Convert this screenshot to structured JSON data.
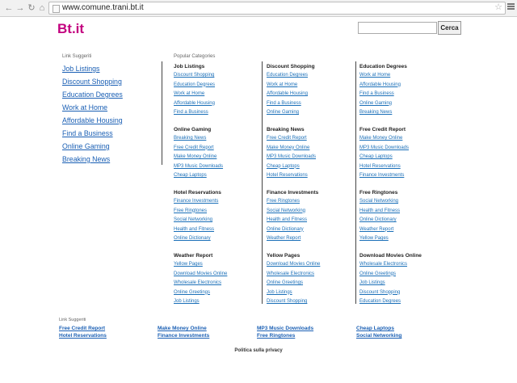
{
  "browser": {
    "url": "www.comune.trani.bt.it"
  },
  "header": {
    "logo": "Bt.it",
    "search_button": "Cerca",
    "search_value": ""
  },
  "left": {
    "heading": "Link Suggeriti",
    "links": [
      "Job Listings",
      "Discount Shopping",
      "Education Degrees",
      "Work at Home",
      "Affordable Housing",
      "Find a Business",
      "Online Gaming",
      "Breaking News"
    ]
  },
  "popular": {
    "heading": "Popular Categories",
    "columns": [
      [
        {
          "title": "Job Listings",
          "links": [
            "Discount Shopping",
            "Education Degrees",
            "Work at Home",
            "Affordable Housing",
            "Find a Business"
          ]
        },
        {
          "title": "Online Gaming",
          "links": [
            "Breaking News",
            "Free Credit Report",
            "Make Money Online",
            "MP3 Music Downloads",
            "Cheap Laptops"
          ]
        },
        {
          "title": "Hotel Reservations",
          "links": [
            "Finance Investments",
            "Free Ringtones",
            "Social Networking",
            "Health and Fitness",
            "Online Dictionary"
          ]
        },
        {
          "title": "Weather Report",
          "links": [
            "Yellow Pages",
            "Download Movies Online",
            "Wholesale Electronics",
            "Online Greetings",
            "Job Listings"
          ]
        }
      ],
      [
        {
          "title": "Discount Shopping",
          "links": [
            "Education Degrees",
            "Work at Home",
            "Affordable Housing",
            "Find a Business",
            "Online Gaming"
          ]
        },
        {
          "title": "Breaking News",
          "links": [
            "Free Credit Report",
            "Make Money Online",
            "MP3 Music Downloads",
            "Cheap Laptops",
            "Hotel Reservations"
          ]
        },
        {
          "title": "Finance Investments",
          "links": [
            "Free Ringtones",
            "Social Networking",
            "Health and Fitness",
            "Online Dictionary",
            "Weather Report"
          ]
        },
        {
          "title": "Yellow Pages",
          "links": [
            "Download Movies Online",
            "Wholesale Electronics",
            "Online Greetings",
            "Job Listings",
            "Discount Shopping"
          ]
        }
      ],
      [
        {
          "title": "Education Degrees",
          "links": [
            "Work at Home",
            "Affordable Housing",
            "Find a Business",
            "Online Gaming",
            "Breaking News"
          ]
        },
        {
          "title": "Free Credit Report",
          "links": [
            "Make Money Online",
            "MP3 Music Downloads",
            "Cheap Laptops",
            "Hotel Reservations",
            "Finance Investments"
          ]
        },
        {
          "title": "Free Ringtones",
          "links": [
            "Social Networking",
            "Health and Fitness",
            "Online Dictionary",
            "Weather Report",
            "Yellow Pages"
          ]
        },
        {
          "title": "Download Movies Online",
          "links": [
            "Wholesale Electronics",
            "Online Greetings",
            "Job Listings",
            "Discount Shopping",
            "Education Degrees"
          ]
        }
      ]
    ]
  },
  "footer": {
    "heading": "Link Suggeriti",
    "links": [
      "Free Credit Report",
      "Make Money Online",
      "MP3 Music Downloads",
      "Cheap Laptops",
      "Hotel Reservations",
      "Finance Investments",
      "Free Ringtones",
      "Social Networking"
    ],
    "privacy": "Politica sulla privacy"
  }
}
